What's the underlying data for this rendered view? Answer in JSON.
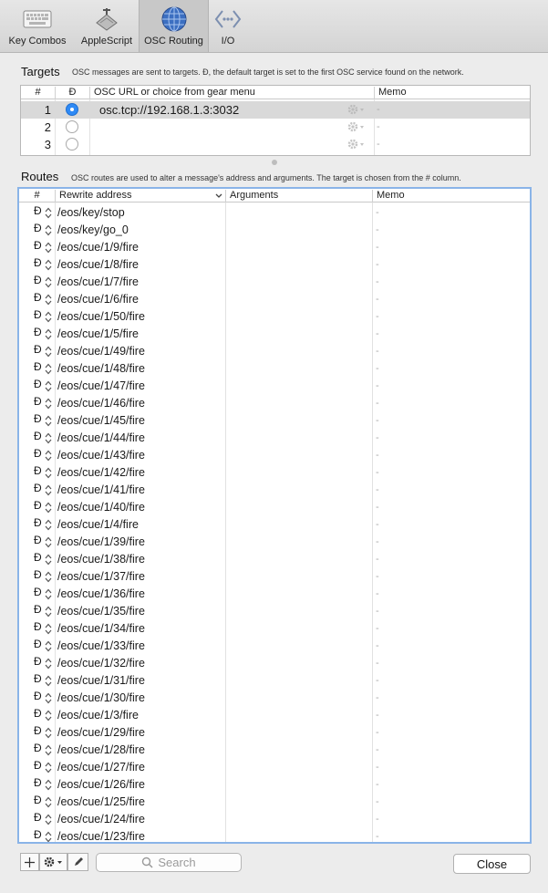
{
  "toolbar": {
    "items": [
      {
        "label": "Key Combos",
        "icon": "keyboard-icon",
        "selected": false
      },
      {
        "label": "AppleScript",
        "icon": "applescript-icon",
        "selected": false
      },
      {
        "label": "OSC Routing",
        "icon": "globe-network-icon",
        "selected": true
      },
      {
        "label": "I/O",
        "icon": "io-arrows-icon",
        "selected": false
      }
    ]
  },
  "targets": {
    "title": "Targets",
    "description": "OSC messages are sent to targets.  Đ, the default target is set to the first OSC service found on the network.",
    "columns": [
      "#",
      "Đ",
      "OSC URL or choice from gear menu",
      "Memo"
    ],
    "rows": [
      {
        "num": "1",
        "default": true,
        "url": "osc.tcp://192.168.1.3:3032",
        "memo": "-"
      },
      {
        "num": "2",
        "default": false,
        "url": "",
        "memo": "-"
      },
      {
        "num": "3",
        "default": false,
        "url": "",
        "memo": "-"
      }
    ]
  },
  "routes": {
    "title": "Routes",
    "description": "OSC routes are used to alter a message's address and arguments.  The target is chosen from the # column.",
    "columns": [
      "#",
      "Rewrite address",
      "Arguments",
      "Memo"
    ],
    "target_symbol": "Đ",
    "memo_placeholder": "-",
    "addresses": [
      "/eos/key/stop",
      "/eos/key/go_0",
      "/eos/cue/1/9/fire",
      "/eos/cue/1/8/fire",
      "/eos/cue/1/7/fire",
      "/eos/cue/1/6/fire",
      "/eos/cue/1/50/fire",
      "/eos/cue/1/5/fire",
      "/eos/cue/1/49/fire",
      "/eos/cue/1/48/fire",
      "/eos/cue/1/47/fire",
      "/eos/cue/1/46/fire",
      "/eos/cue/1/45/fire",
      "/eos/cue/1/44/fire",
      "/eos/cue/1/43/fire",
      "/eos/cue/1/42/fire",
      "/eos/cue/1/41/fire",
      "/eos/cue/1/40/fire",
      "/eos/cue/1/4/fire",
      "/eos/cue/1/39/fire",
      "/eos/cue/1/38/fire",
      "/eos/cue/1/37/fire",
      "/eos/cue/1/36/fire",
      "/eos/cue/1/35/fire",
      "/eos/cue/1/34/fire",
      "/eos/cue/1/33/fire",
      "/eos/cue/1/32/fire",
      "/eos/cue/1/31/fire",
      "/eos/cue/1/30/fire",
      "/eos/cue/1/3/fire",
      "/eos/cue/1/29/fire",
      "/eos/cue/1/28/fire",
      "/eos/cue/1/27/fire",
      "/eos/cue/1/26/fire",
      "/eos/cue/1/25/fire",
      "/eos/cue/1/24/fire",
      "/eos/cue/1/23/fire"
    ]
  },
  "bottom_bar": {
    "search_placeholder": "Search",
    "close_label": "Close"
  },
  "colors": {
    "selection_radio": "#2f8af5",
    "focus_ring": "#8ab4e8"
  }
}
